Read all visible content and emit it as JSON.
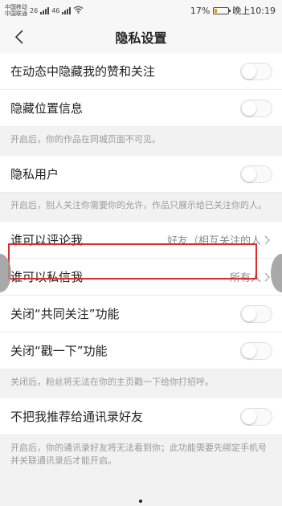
{
  "status_bar": {
    "carrier1": "中国移动",
    "carrier2": "中国联通",
    "network1": "26",
    "network2": "46",
    "battery": "17%",
    "time": "晚上10:19"
  },
  "nav": {
    "title": "隐私设置",
    "back_icon": "chevron-left-icon"
  },
  "rows": {
    "hide_likes": {
      "label": "在动态中隐藏我的赞和关注",
      "toggle_on": false
    },
    "hide_location": {
      "label": "隐藏位置信息",
      "toggle_on": false,
      "desc": "开启后，你的作品在同城页面不可见。"
    },
    "private_user": {
      "label": "隐私用户",
      "toggle_on": false,
      "desc": "开启后，别人关注你需要你的允许，作品只展示给已关注你的人。"
    },
    "who_comment": {
      "label": "谁可以评论我",
      "value": "好友（相互关注的人"
    },
    "who_message": {
      "label": "谁可以私信我",
      "value": "所有人"
    },
    "close_mutual": {
      "label": "关闭“共同关注”功能",
      "toggle_on": false
    },
    "close_poke": {
      "label": "关闭“戳一下”功能",
      "toggle_on": false,
      "desc": "关闭后，粉丝将无法在你的主页戳一下给你打招呼。"
    },
    "no_recommend": {
      "label": "不把我推荐给通讯录好友",
      "toggle_on": false,
      "desc": "开启后，你的通讯录好友将无法看到你；此功能需要先绑定手机号并关联通讯录后才能开启。"
    }
  },
  "colors": {
    "highlight": "#d92d2d",
    "battery_fill": "#e8a000"
  }
}
